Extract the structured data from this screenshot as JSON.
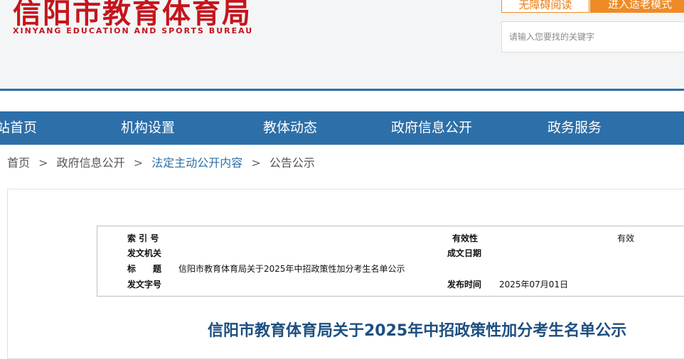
{
  "header": {
    "logo_title": "信阳市教育体育局",
    "logo_subtitle": "XINYANG EDUCATION AND SPORTS BUREAU",
    "accessible_reading": "无障碍阅读",
    "elder_mode": "进入适老模式",
    "search_placeholder": "请输入您要找的关键字"
  },
  "nav": {
    "items": [
      "站首页",
      "机构设置",
      "教体动态",
      "政府信息公开",
      "政务服务"
    ]
  },
  "breadcrumb": {
    "items": [
      "首页",
      "政府信息公开",
      "法定主动公开内容",
      "公告公示"
    ],
    "separator": ">"
  },
  "meta": {
    "index_label": "索 引 号",
    "index_value": "",
    "validity_label": "有效性",
    "validity_value": "有效",
    "issuer_label": "发文机关",
    "issuer_value": "",
    "date_label": "成文日期",
    "date_value": "",
    "title_label": "标　　题",
    "title_value": "信阳市教育体育局关于2025年中招政策性加分考生名单公示",
    "docno_label": "发文字号",
    "docno_value": "",
    "publish_label": "发布时间",
    "publish_value": "2025年07月01日"
  },
  "article": {
    "title": "信阳市教育体育局关于2025年中招政策性加分考生名单公示"
  },
  "colors": {
    "brand_red": "#c5151c",
    "nav_blue": "#2d6fa8",
    "accent_orange": "#f08a24",
    "title_blue": "#1d4f80"
  }
}
